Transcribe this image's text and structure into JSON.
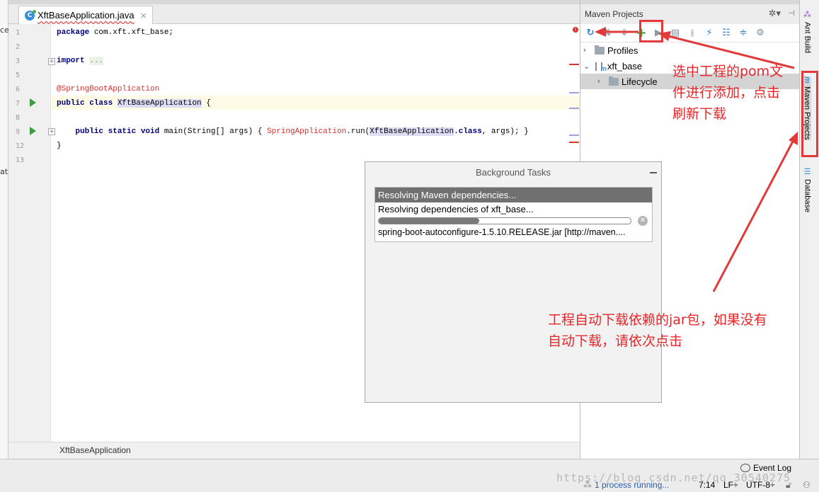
{
  "editor": {
    "tab_title": "XftBaseApplication.java",
    "tab_icon_letter": "C",
    "close_glyph": "×",
    "lines": [
      {
        "no": "1",
        "parts": [
          [
            "kw",
            "package"
          ],
          [
            "",
            " com.xft.xft_base;"
          ]
        ]
      },
      {
        "no": "2",
        "parts": []
      },
      {
        "no": "3",
        "parts": [
          [
            "kw",
            "import"
          ],
          [
            "",
            " "
          ],
          [
            "fold-text",
            "..."
          ]
        ]
      },
      {
        "no": "5",
        "parts": []
      },
      {
        "no": "6",
        "parts": [
          [
            "ann",
            "@SpringBootApplication"
          ]
        ]
      },
      {
        "no": "7",
        "parts": [
          [
            "kw",
            "public class"
          ],
          [
            "",
            " "
          ],
          [
            "hl",
            "XftBaseApplication"
          ],
          [
            "",
            " {"
          ]
        ]
      },
      {
        "no": "8",
        "parts": []
      },
      {
        "no": "9",
        "parts": [
          [
            "",
            "    "
          ],
          [
            "kw",
            "public static void"
          ],
          [
            "",
            " main(String[] args) { "
          ],
          [
            "ann",
            "SpringApplication"
          ],
          [
            "",
            ".run("
          ],
          [
            "hl",
            "XftBaseApplication"
          ],
          [
            "kw",
            ".class"
          ],
          [
            "",
            ", args); }"
          ]
        ]
      },
      {
        "no": "12",
        "parts": [
          [
            "",
            "}"
          ]
        ]
      },
      {
        "no": "13",
        "parts": []
      }
    ],
    "breadcrumb": "XftBaseApplication",
    "error_badge": "!"
  },
  "left_strip": {
    "top_text": "ce",
    "mid_text": "ati"
  },
  "maven": {
    "title": "Maven Projects",
    "gear_glyph": "✲▾",
    "pin_glyph": "⊣",
    "toolbar_icons": [
      "refresh-icon",
      "generate-icon",
      "download-icon",
      "add-icon",
      "run-icon",
      "execute-goal-icon",
      "toggle-offline-icon",
      "skip-tests-icon",
      "show-dependencies-icon",
      "collapse-all-icon",
      "settings-icon"
    ],
    "tree": {
      "profiles": "Profiles",
      "project": "xft_base",
      "lifecycle": "Lifecycle"
    }
  },
  "side_tabs": {
    "ant_build": "Ant Build",
    "maven_projects": "Maven Projects",
    "database": "Database"
  },
  "background_tasks": {
    "title": "Background Tasks",
    "task_header": "Resolving Maven dependencies...",
    "task_line": "Resolving dependencies of xft_base...",
    "task_jar": "spring-boot-autoconfigure-1.5.10.RELEASE.jar [http://maven....",
    "progress": 0.4,
    "cancel_glyph": "✕"
  },
  "status": {
    "event_log": "Event Log",
    "process": "1 process running...",
    "position": "7:14",
    "line_sep": "LF÷",
    "encoding": "UTF-8÷",
    "watermark": "https://blog.csdn.net/qq_30540275"
  },
  "annotations": {
    "note1_line1": "选中工程的pom文",
    "note1_line2": "件进行添加，点击",
    "note1_line3": "刷新下载",
    "note2_line1": "工程自动下载依赖的jar包，如果没有",
    "note2_line2": "自动下载，请依次点击",
    "color": "#e8262a"
  }
}
